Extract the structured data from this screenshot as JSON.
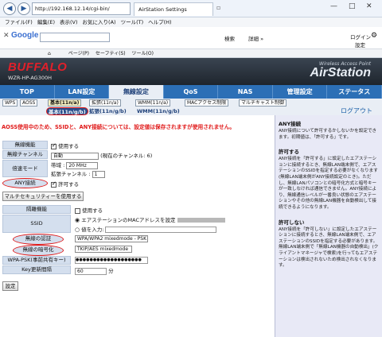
{
  "browser": {
    "url": "http://192.168.12.14/cgi-bin/",
    "tab_title": "AirStation Settings",
    "menu": [
      "ファイル(F)",
      "編集(E)",
      "表示(V)",
      "お気に入り(A)",
      "ツール(T)",
      "ヘルプ(H)"
    ],
    "google_logo": "Google",
    "search_label": "検索",
    "more_label": "詳細 »",
    "login_label": "ログイン",
    "settings_label": "設定",
    "cmd_items": [
      "ページ(P)",
      "セーフティ(S)",
      "ツール(O)"
    ]
  },
  "router": {
    "logo": "BUFFALO",
    "model": "WZR-HP-AG300H",
    "tagline": "Wireless Access Point",
    "brand": "AirStation"
  },
  "tabs": [
    "TOP",
    "LAN設定",
    "無線設定",
    "QoS",
    "NAS",
    "管理設定",
    "ステータス"
  ],
  "active_tab": "無線設定",
  "subtabs_row1": [
    "WPS",
    "AOSS",
    "基本(11n/a)",
    "拡張(11n/a)",
    "WMM(11n/a)",
    "MACアクセス制限",
    "マルチキャスト制御"
  ],
  "subtabs_row2": [
    "基本(11n/g/b)",
    "拡張(11n/g/b)",
    "WMM(11n/g/b)"
  ],
  "logout": "ログアウト",
  "warning": "AOSS使用中のため、SSIDと、ANY接続については、設定値は保存されますが使用されません。",
  "form": {
    "wireless_func_label": "無線機能",
    "wireless_func_value": "使用する",
    "channel_label": "無線チャンネル",
    "channel_value": "自動",
    "channel_current": "(現在のチャンネル: 6)",
    "speed_label": "倍速モード",
    "bandwidth_label": "帯域 :",
    "bandwidth_value": "20 MHz",
    "ext_channel_label": "拡張チャンネル :",
    "ext_channel_value": "1",
    "any_label": "ANY接続",
    "any_value": "許可する",
    "multi_security_button": "マルチセキュリティーを使用する",
    "stealth_label": "隔離機能",
    "stealth_value": "使用する",
    "ssid_label": "SSID",
    "ssid_option1": "エアステーションのMACアドレスを設定",
    "ssid_option2": "値を入力:",
    "auth_label": "無線の認証",
    "auth_value": "WPA/WPA2 mixedmode - PSK",
    "enc_label": "無線の暗号化",
    "enc_value": "TKIP/AES mixedmode",
    "psk_label": "WPA-PSK(事前共有キー)",
    "psk_value": "●●●●●●●●●●●●●●●●●●●",
    "key_interval_label": "Key更新間隔",
    "key_interval_value": "60",
    "key_interval_unit": "分",
    "apply_button": "設定"
  },
  "help": {
    "title": "ANY接続",
    "intro": "ANY接続について許可するかしないかを設定できます。初期値は、「許可する」です。",
    "allow_title": "許可する",
    "allow_text": "ANY接続を「許可する」に設定したエアステーションに接続するとき、無線LAN端末側で、エアステーションのSSIDを指定する必要がなくなります(無線LAN端末側がANY接続設定のとき)。ただし、無線LANパソコンとの暗号化方式と暗号キーが一致しなければ通信できません。ANY接続により、無線通信レベルが一番良い状態のエアステーションやその他の無線LAN機器を自動検出して接続できるようになります。",
    "deny_title": "許可しない",
    "deny_text": "ANY接続を「許可しない」に設定したエアステーションに接続するとき、無線LAN端末側で、エアステーションのSSIDを指定する必要があります。無線LAN端末側で「無線LAN機器の自動検出」(クライアントマネージャで検索)を行ってもエアステーションは検出されないため検出されなくなります。"
  }
}
